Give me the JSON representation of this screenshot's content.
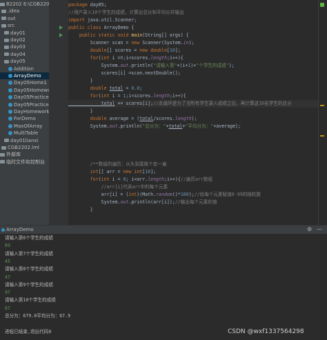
{
  "sidebar": {
    "items": [
      {
        "label": "B2202  E:\\CGB2202",
        "kind": "root"
      },
      {
        "label": ".idea",
        "kind": "folder"
      },
      {
        "label": "out",
        "kind": "folder"
      },
      {
        "label": "src",
        "kind": "folder"
      },
      {
        "label": "day01",
        "kind": "folder"
      },
      {
        "label": "day02",
        "kind": "folder"
      },
      {
        "label": "day03",
        "kind": "folder"
      },
      {
        "label": "day04",
        "kind": "folder"
      },
      {
        "label": "day05",
        "kind": "folder"
      },
      {
        "label": "Addition",
        "kind": "class"
      },
      {
        "label": "ArrayDemo",
        "kind": "class",
        "selected": true
      },
      {
        "label": "Day05Home1",
        "kind": "class"
      },
      {
        "label": "Day05Homewor",
        "kind": "class"
      },
      {
        "label": "Day05Practice1",
        "kind": "class"
      },
      {
        "label": "Day05Practice2",
        "kind": "class"
      },
      {
        "label": "DayHomework",
        "kind": "class"
      },
      {
        "label": "ForDemo",
        "kind": "class"
      },
      {
        "label": "MaxOfArray",
        "kind": "class"
      },
      {
        "label": "MultiTable",
        "kind": "class"
      },
      {
        "label": "day01lianxi",
        "kind": "folder"
      },
      {
        "label": "CGB2202.iml",
        "kind": "file"
      },
      {
        "label": "外部库",
        "kind": "lib"
      },
      {
        "label": "临时文件和控制台",
        "kind": "lib"
      }
    ]
  },
  "editor": {
    "lines": [
      [
        {
          "t": "package ",
          "c": "k"
        },
        {
          "t": "day05;",
          "c": ""
        }
      ],
      [
        {
          "t": "//用户录入10个学生的成绩，计算出总分和平均分并输出",
          "c": "c"
        }
      ],
      [
        {
          "t": "import ",
          "c": "k"
        },
        {
          "t": "java.util.Scanner;",
          "c": ""
        }
      ],
      [
        {
          "t": "public class ",
          "c": "k"
        },
        {
          "t": "ArrayDemo {",
          "c": ""
        }
      ],
      [
        {
          "t": "    public static void ",
          "c": "k"
        },
        {
          "t": "main",
          "c": "f"
        },
        {
          "t": "(String[] args) {",
          "c": ""
        }
      ],
      [
        {
          "t": "        Scanner scan = ",
          "c": ""
        },
        {
          "t": "new ",
          "c": "k"
        },
        {
          "t": "Scanner(System.",
          "c": ""
        },
        {
          "t": "in",
          "c": "st"
        },
        {
          "t": ");",
          "c": ""
        }
      ],
      [
        {
          "t": "        double",
          "c": "k"
        },
        {
          "t": "[] scores = ",
          "c": ""
        },
        {
          "t": "new double",
          "c": "k"
        },
        {
          "t": "[",
          "c": ""
        },
        {
          "t": "10",
          "c": "n"
        },
        {
          "t": "];",
          "c": ""
        }
      ],
      [
        {
          "t": "        for",
          "c": "k"
        },
        {
          "t": "(",
          "c": ""
        },
        {
          "t": "int ",
          "c": "k"
        },
        {
          "t": "i =",
          "c": ""
        },
        {
          "t": "0",
          "c": "n"
        },
        {
          "t": ";i<scores.",
          "c": ""
        },
        {
          "t": "length",
          "c": "st"
        },
        {
          "t": ";i++){",
          "c": ""
        }
      ],
      [
        {
          "t": "            System.",
          "c": ""
        },
        {
          "t": "out",
          "c": "st"
        },
        {
          "t": ".println(",
          "c": ""
        },
        {
          "t": "\"请输入第\"",
          "c": "s"
        },
        {
          "t": "+(i+",
          "c": ""
        },
        {
          "t": "1",
          "c": "n"
        },
        {
          "t": ")+",
          "c": ""
        },
        {
          "t": "\"个学生的成绩\"",
          "c": "s"
        },
        {
          "t": ");",
          "c": ""
        }
      ],
      [
        {
          "t": "            scores[i] =scan.nextDouble();",
          "c": ""
        }
      ],
      [
        {
          "t": "        }",
          "c": ""
        }
      ],
      [
        {
          "t": "        double ",
          "c": "k"
        },
        {
          "t": "total",
          "c": "u"
        },
        {
          "t": " = ",
          "c": ""
        },
        {
          "t": "0.0",
          "c": "n"
        },
        {
          "t": ";",
          "c": ""
        }
      ],
      [
        {
          "t": "        for",
          "c": "k"
        },
        {
          "t": "(",
          "c": ""
        },
        {
          "t": "int ",
          "c": "k"
        },
        {
          "t": "i = ",
          "c": ""
        },
        {
          "t": "1",
          "c": "n"
        },
        {
          "t": ";i<scores.",
          "c": ""
        },
        {
          "t": "length",
          "c": "st"
        },
        {
          "t": ";i++){",
          "c": ""
        }
      ],
      [
        {
          "t": "            total",
          "c": "u"
        },
        {
          "t": " += scores[i];",
          "c": ""
        },
        {
          "t": "//此循环是为了当所有学生录入成绩之后，再计算这10名学生的总分",
          "c": "c"
        }
      ],
      [
        {
          "t": "        }",
          "c": ""
        }
      ],
      [
        {
          "t": "        double ",
          "c": "k"
        },
        {
          "t": "average = (",
          "c": ""
        },
        {
          "t": "total",
          "c": "u"
        },
        {
          "t": "/scores.",
          "c": ""
        },
        {
          "t": "length",
          "c": "st"
        },
        {
          "t": ");",
          "c": ""
        }
      ],
      [
        {
          "t": "        System.",
          "c": ""
        },
        {
          "t": "out",
          "c": "st"
        },
        {
          "t": ".println(",
          "c": ""
        },
        {
          "t": "\"总分为：\"",
          "c": "s"
        },
        {
          "t": "+",
          "c": ""
        },
        {
          "t": "total",
          "c": "u"
        },
        {
          "t": "+",
          "c": ""
        },
        {
          "t": "\"平均分为：\"",
          "c": "s"
        },
        {
          "t": "+average);",
          "c": ""
        }
      ],
      [
        {
          "t": "",
          "c": ""
        }
      ],
      [
        {
          "t": "",
          "c": ""
        }
      ],
      [
        {
          "t": "",
          "c": ""
        }
      ],
      [
        {
          "t": "",
          "c": ""
        }
      ],
      [
        {
          "t": "        /**数组的遍历：从头到尾挨个走一遍",
          "c": "c"
        }
      ],
      [
        {
          "t": "        int",
          "c": "k"
        },
        {
          "t": "[] arr = ",
          "c": ""
        },
        {
          "t": "new int",
          "c": "k"
        },
        {
          "t": "[",
          "c": ""
        },
        {
          "t": "10",
          "c": "n"
        },
        {
          "t": "];",
          "c": ""
        }
      ],
      [
        {
          "t": "        for",
          "c": "k"
        },
        {
          "t": "(",
          "c": ""
        },
        {
          "t": "int ",
          "c": "k"
        },
        {
          "t": "i = ",
          "c": ""
        },
        {
          "t": "0",
          "c": "n"
        },
        {
          "t": "; i<arr.",
          "c": ""
        },
        {
          "t": "length",
          "c": "st"
        },
        {
          "t": ";i++){",
          "c": ""
        },
        {
          "t": "//遍历arr数组",
          "c": "c"
        }
      ],
      [
        {
          "t": "            //arr[i]代表arr中的每个元素",
          "c": "c"
        }
      ],
      [
        {
          "t": "            arr[i] = (",
          "c": ""
        },
        {
          "t": "int",
          "c": "k"
        },
        {
          "t": ")(Math.",
          "c": ""
        },
        {
          "t": "random",
          "c": "st"
        },
        {
          "t": "()*",
          "c": ""
        },
        {
          "t": "100",
          "c": "n"
        },
        {
          "t": ");",
          "c": ""
        },
        {
          "t": "//给每个元素赋值0-99的随机数",
          "c": "c"
        }
      ],
      [
        {
          "t": "            System.",
          "c": ""
        },
        {
          "t": "out",
          "c": "st"
        },
        {
          "t": ".println(arr[i]);",
          "c": ""
        },
        {
          "t": "//输出每个元素的值",
          "c": "c"
        }
      ],
      [
        {
          "t": "        }",
          "c": ""
        }
      ]
    ]
  },
  "run_panel": {
    "tab_label": "ArrayDemo",
    "gear_icon": "gear-icon",
    "minimize_glyph": "—"
  },
  "console": {
    "lines": [
      {
        "t": "请输入第6个学生的成绩",
        "kind": "out"
      },
      {
        "t": "69",
        "kind": "input"
      },
      {
        "t": "请输入第7个学生的成绩",
        "kind": "out"
      },
      {
        "t": "45",
        "kind": "input"
      },
      {
        "t": "请输入第8个学生的成绩",
        "kind": "out"
      },
      {
        "t": "47",
        "kind": "input"
      },
      {
        "t": "请输入第9个学生的成绩",
        "kind": "out"
      },
      {
        "t": "97",
        "kind": "input"
      },
      {
        "t": "请输入第10个学生的成绩",
        "kind": "out"
      },
      {
        "t": "67",
        "kind": "input"
      },
      {
        "t": "总分为：679.0平均分为：67.9",
        "kind": "out"
      },
      {
        "t": "",
        "kind": "out"
      },
      {
        "t": "进程已结束,退出代码0",
        "kind": "out"
      }
    ]
  },
  "watermark": "CSDN @wxf1337564298"
}
